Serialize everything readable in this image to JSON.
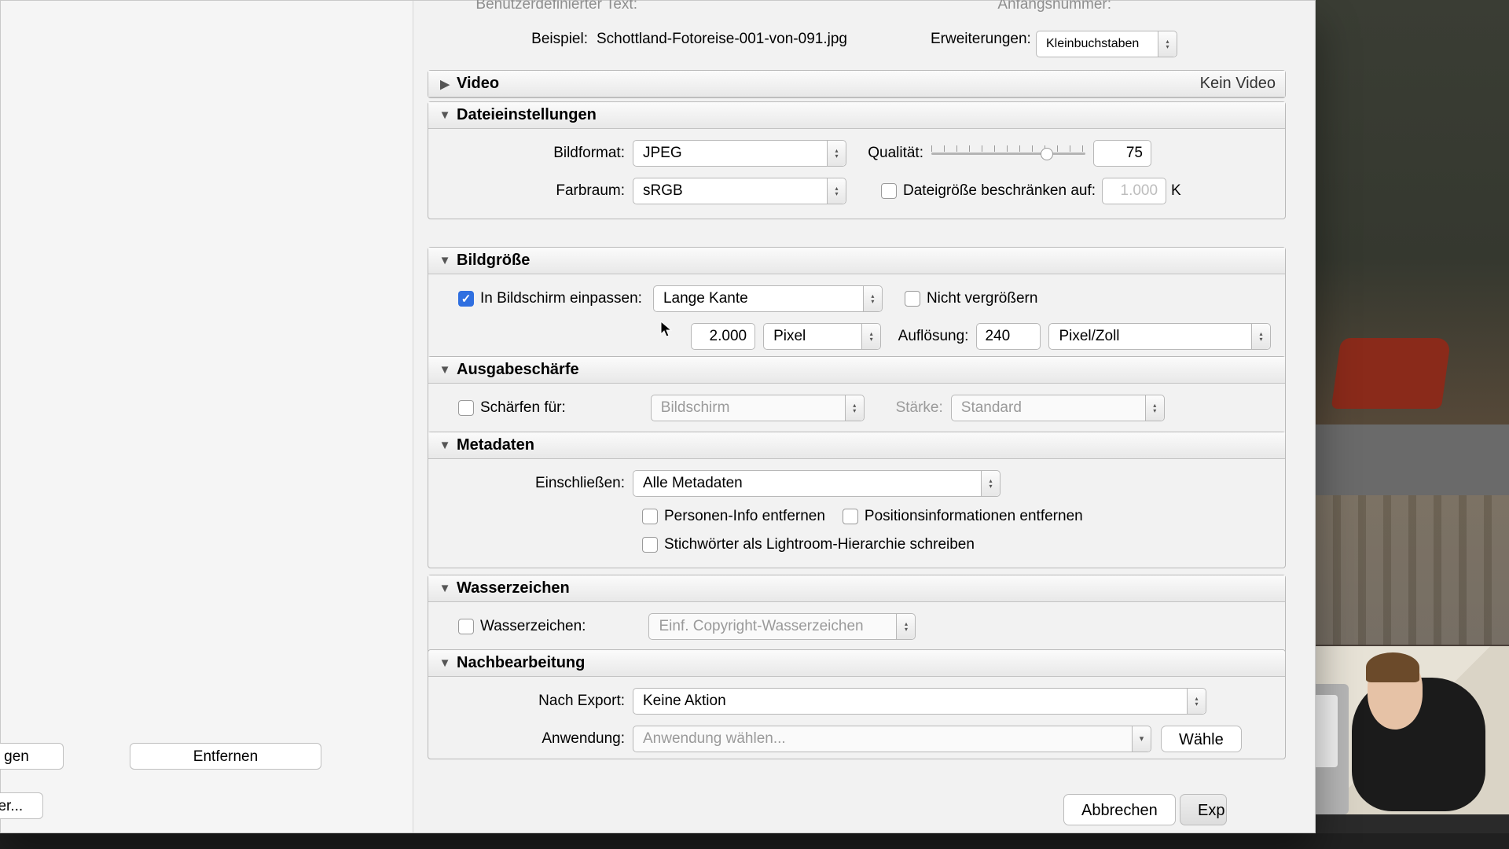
{
  "naming": {
    "custom_text_label": "Benutzerdefinierter Text:",
    "start_number_label": "Anfangsnummer:",
    "example_label": "Beispiel:",
    "example_value": "Schottland-Fotoreise-001-von-091.jpg",
    "extensions_label": "Erweiterungen:",
    "extensions_value": "Kleinbuchstaben"
  },
  "video": {
    "title": "Video",
    "status": "Kein Video"
  },
  "files": {
    "title": "Dateieinstellungen",
    "format_label": "Bildformat:",
    "format_value": "JPEG",
    "quality_label": "Qualität:",
    "quality_value": "75",
    "quality_percent": 75,
    "colorspace_label": "Farbraum:",
    "colorspace_value": "sRGB",
    "limit_label": "Dateigröße beschränken auf:",
    "limit_value": "1.000",
    "limit_unit": "K"
  },
  "size": {
    "title": "Bildgröße",
    "fit_label": "In Bildschirm einpassen:",
    "fit_value": "Lange Kante",
    "no_enlarge_label": "Nicht vergrößern",
    "dim_value": "2.000",
    "dim_unit": "Pixel",
    "res_label": "Auflösung:",
    "res_value": "240",
    "res_unit": "Pixel/Zoll"
  },
  "sharp": {
    "title": "Ausgabeschärfe",
    "enable_label": "Schärfen für:",
    "target_value": "Bildschirm",
    "strength_label": "Stärke:",
    "strength_value": "Standard"
  },
  "meta": {
    "title": "Metadaten",
    "include_label": "Einschließen:",
    "include_value": "Alle Metadaten",
    "remove_person": "Personen-Info entfernen",
    "remove_location": "Positionsinformationen entfernen",
    "write_hierarchy": "Stichwörter als Lightroom-Hierarchie schreiben"
  },
  "watermark": {
    "title": "Wasserzeichen",
    "enable_label": "Wasserzeichen:",
    "value": "Einf. Copyright-Wasserzeichen"
  },
  "post": {
    "title": "Nachbearbeitung",
    "after_label": "Nach Export:",
    "after_value": "Keine Aktion",
    "app_label": "Anwendung:",
    "app_placeholder": "Anwendung wählen...",
    "choose_btn": "Wähle"
  },
  "sidebar": {
    "add": "gen",
    "remove": "Entfernen",
    "preset": "ger..."
  },
  "footer": {
    "cancel": "Abbrechen",
    "export": "Exp"
  }
}
